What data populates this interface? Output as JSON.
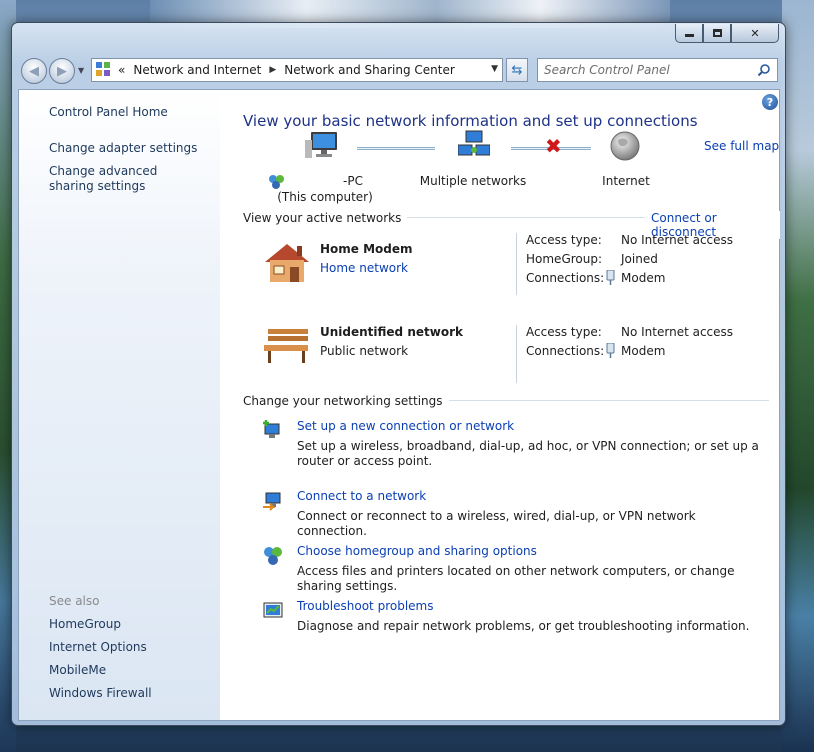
{
  "window": {
    "controls": {
      "minimize": "minimize",
      "maximize": "maximize",
      "close": "✕"
    }
  },
  "address": {
    "crumbs_prefix": "«",
    "crumb1": "Network and Internet",
    "crumb2": "Network and Sharing Center"
  },
  "search": {
    "placeholder": "Search Control Panel"
  },
  "sidebar": {
    "home": "Control Panel Home",
    "items": [
      "Change adapter settings",
      "Change advanced sharing settings"
    ],
    "see_also_heading": "See also",
    "see_also": [
      "HomeGroup",
      "Internet Options",
      "MobileMe",
      "Windows Firewall"
    ]
  },
  "main": {
    "help": "?",
    "title": "View your basic network information and set up connections",
    "see_full_map": "See full map",
    "map": {
      "computer_name": "-PC",
      "computer_sub": "(This computer)",
      "middle": "Multiple networks",
      "right": "Internet"
    },
    "active_heading": "View your active networks",
    "connect_disconnect": "Connect or disconnect",
    "networks": [
      {
        "name": "Home Modem",
        "type": "Home network",
        "access_label": "Access type:",
        "access_value": "No Internet access",
        "homegroup_label": "HomeGroup:",
        "homegroup_value": "Joined",
        "conn_label": "Connections:",
        "conn_value": "Modem"
      },
      {
        "name": "Unidentified network",
        "type": "Public network",
        "access_label": "Access type:",
        "access_value": "No Internet access",
        "conn_label": "Connections:",
        "conn_value": "Modem"
      }
    ],
    "settings_heading": "Change your networking settings",
    "tasks": [
      {
        "title": "Set up a new connection or network",
        "desc": "Set up a wireless, broadband, dial-up, ad hoc, or VPN connection; or set up a router or access point."
      },
      {
        "title": "Connect to a network",
        "desc": "Connect or reconnect to a wireless, wired, dial-up, or VPN network connection."
      },
      {
        "title": "Choose homegroup and sharing options",
        "desc": "Access files and printers located on other network computers, or change sharing settings."
      },
      {
        "title": "Troubleshoot problems",
        "desc": "Diagnose and repair network problems, or get troubleshooting information."
      }
    ]
  },
  "colors": {
    "link": "#0a3fb3",
    "title": "#1e3287",
    "sidebar_link": "#1e395b",
    "error_x": "#d0181b"
  }
}
